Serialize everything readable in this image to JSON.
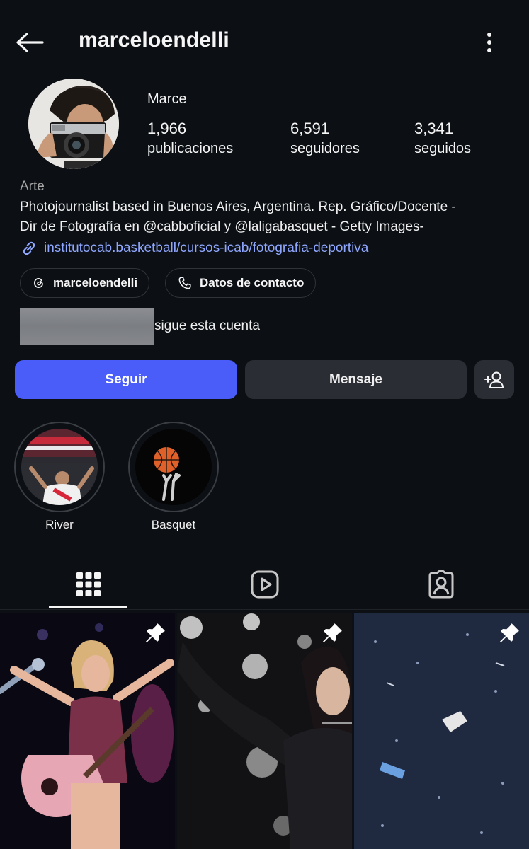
{
  "header": {
    "username": "marceloendelli"
  },
  "profile": {
    "display_name": "Marce",
    "stats": [
      {
        "value": "1,966",
        "label": "publicaciones"
      },
      {
        "value": "6,591",
        "label": "seguidores"
      },
      {
        "value": "3,341",
        "label": "seguidos"
      }
    ],
    "category": "Arte",
    "bio_line1": "Photojournalist based in Buenos Aires, Argentina. Rep. Gráfico/Docente -",
    "bio_line2": "Dir de Fotografía en @cabboficial y @laligabasquet - Getty Images-",
    "link": "institutocab.basketball/cursos-icab/fotografia-deportiva"
  },
  "chips": {
    "threads_label": "marceloendelli",
    "contact_label": "Datos de contacto"
  },
  "followed_by": {
    "text": "sigue esta cuenta"
  },
  "actions": {
    "follow_label": "Seguir",
    "message_label": "Mensaje"
  },
  "highlights": [
    {
      "label": "River"
    },
    {
      "label": "Basquet"
    }
  ],
  "tabs": [
    "grid-icon",
    "reels-icon",
    "tagged-icon"
  ],
  "colors": {
    "background": "#0c1014",
    "accent": "#4a5df9",
    "link": "#8fa7ff",
    "button_dark": "#2a2e34"
  }
}
